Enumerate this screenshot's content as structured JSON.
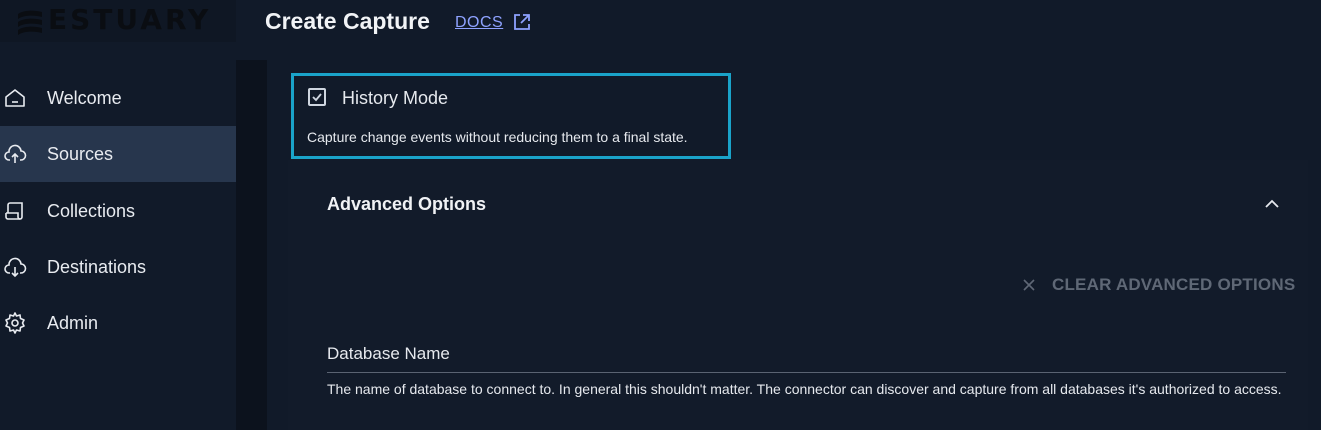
{
  "brand": {
    "name": "ESTUARY"
  },
  "header": {
    "title": "Create Capture",
    "docs_label": "DOCS"
  },
  "sidebar": {
    "items": [
      {
        "label": "Welcome",
        "icon": "home-icon",
        "active": false
      },
      {
        "label": "Sources",
        "icon": "cloud-upload-icon",
        "active": true
      },
      {
        "label": "Collections",
        "icon": "scroll-icon",
        "active": false
      },
      {
        "label": "Destinations",
        "icon": "cloud-download-icon",
        "active": false
      },
      {
        "label": "Admin",
        "icon": "gear-icon",
        "active": false
      }
    ]
  },
  "history_mode": {
    "label": "History Mode",
    "checked": true,
    "description": "Capture change events without reducing them to a final state."
  },
  "advanced": {
    "title": "Advanced Options",
    "clear_label": "CLEAR ADVANCED OPTIONS",
    "database_name": {
      "label": "Database Name",
      "value": "",
      "help": "The name of database to connect to. In general this shouldn't matter. The connector can discover and capture from all databases it's authorized to access."
    }
  },
  "colors": {
    "background": "#111a29",
    "sidebar_active": "#27364d",
    "highlight_border": "#1aa3c9",
    "link": "#8ea2ff",
    "disabled_text": "#5f6876"
  }
}
